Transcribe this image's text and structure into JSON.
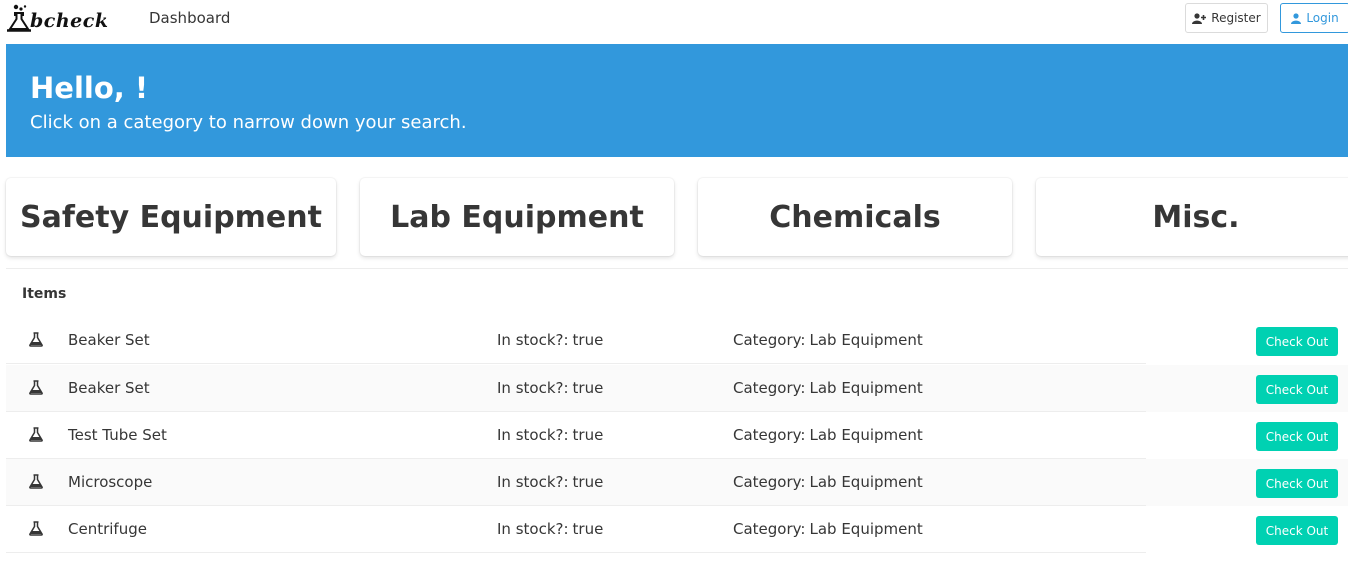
{
  "navbar": {
    "logo_text": "bcheck",
    "dashboard_link": "Dashboard",
    "register_label": "Register",
    "login_label": "Login"
  },
  "hero": {
    "title": "Hello, !",
    "subtitle": "Click on a category to narrow down your search."
  },
  "categories": [
    "Safety Equipment",
    "Lab Equipment",
    "Chemicals",
    "Misc."
  ],
  "items_panel": {
    "heading": "Items",
    "stock_label": "In stock?:",
    "category_label": "Category:",
    "checkout_label": "Check Out",
    "rows": [
      {
        "name": "Beaker Set",
        "in_stock": "true",
        "category": "Lab Equipment"
      },
      {
        "name": "Beaker Set",
        "in_stock": "true",
        "category": "Lab Equipment"
      },
      {
        "name": "Test Tube Set",
        "in_stock": "true",
        "category": "Lab Equipment"
      },
      {
        "name": "Microscope",
        "in_stock": "true",
        "category": "Lab Equipment"
      },
      {
        "name": "Centrifuge",
        "in_stock": "true",
        "category": "Lab Equipment"
      }
    ]
  },
  "colors": {
    "hero_background": "#3298dc",
    "checkout_button": "#00d1b2",
    "login_accent": "#3298dc"
  },
  "icons": {
    "item_icon": "flask-icon",
    "register_icon": "user-plus-icon",
    "login_icon": "user-icon"
  }
}
